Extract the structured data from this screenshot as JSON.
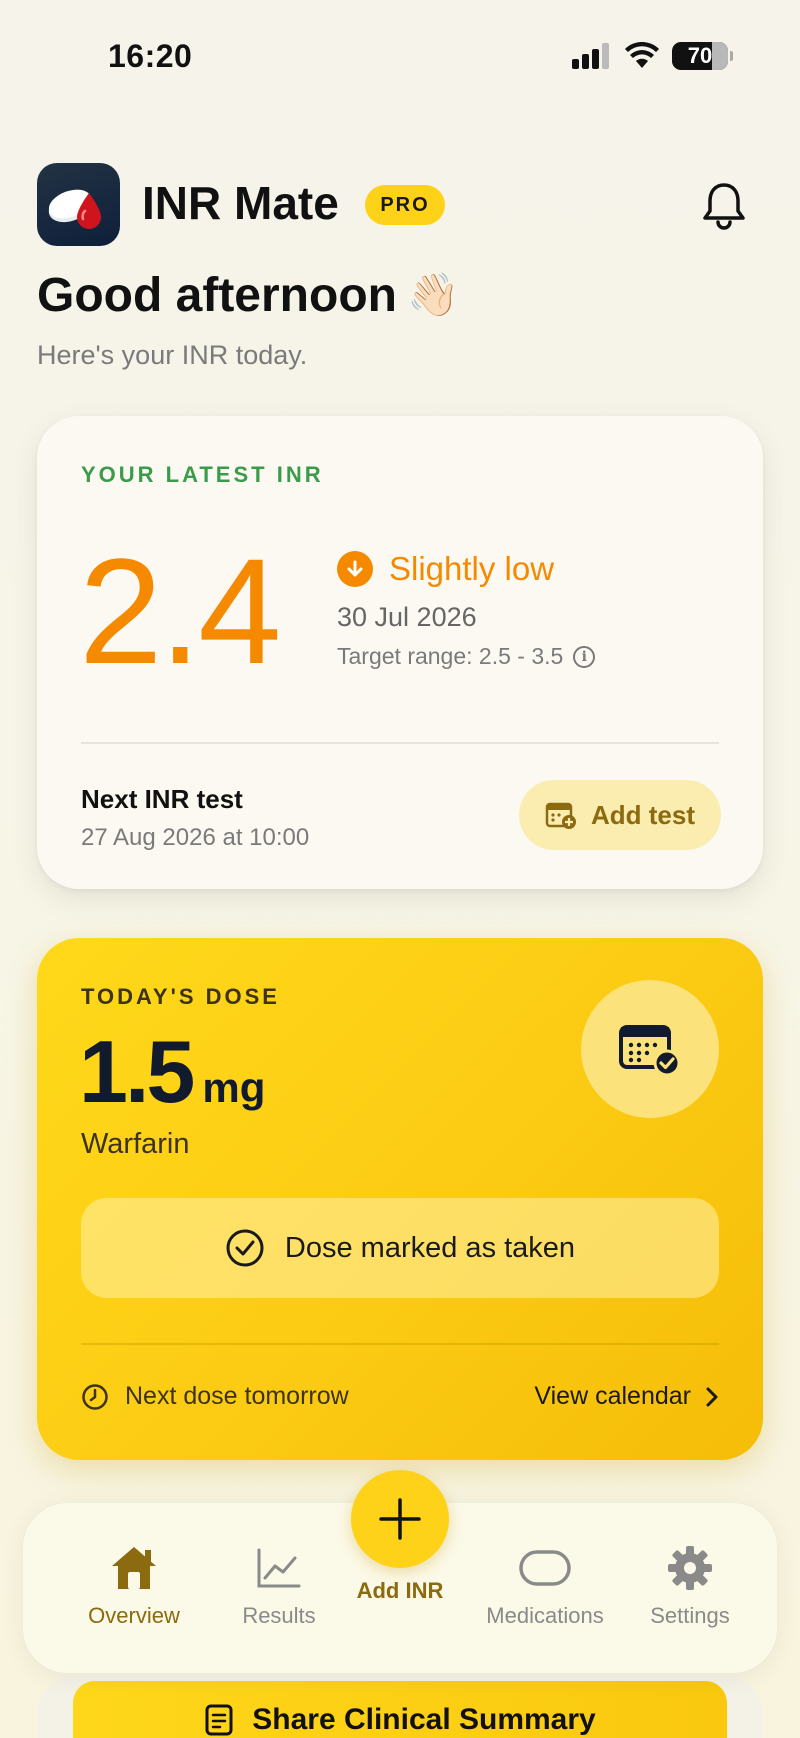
{
  "status_bar": {
    "time": "16:20",
    "battery": "70"
  },
  "header": {
    "app_name": "INR Mate",
    "badge": "PRO"
  },
  "greeting": {
    "title": "Good afternoon",
    "emoji": "👋🏻",
    "subtitle": "Here's your INR today."
  },
  "inr_card": {
    "label": "YOUR LATEST INR",
    "value": "2.4",
    "status": "Slightly low",
    "date": "30 Jul 2026",
    "target_range": "Target range: 2.5 - 3.5",
    "next_test_label": "Next INR test",
    "next_test_date": "27 Aug 2026 at 10:00",
    "add_test_label": "Add test",
    "accent_color": "#f58a00"
  },
  "dose_card": {
    "label": "TODAY'S DOSE",
    "value": "1.5",
    "unit": "mg",
    "drug": "Warfarin",
    "taken_label": "Dose marked as taken",
    "next_dose": "Next dose tomorrow",
    "view_calendar": "View calendar"
  },
  "tabbar": {
    "tabs": [
      {
        "label": "Overview",
        "icon": "home-icon",
        "active": true
      },
      {
        "label": "Results",
        "icon": "chart-line-icon",
        "active": false
      },
      {
        "label": "Medications",
        "icon": "pill-icon",
        "active": false
      },
      {
        "label": "Settings",
        "icon": "gear-icon",
        "active": false
      }
    ],
    "fab_label": "Add INR"
  },
  "share": {
    "label": "Share Clinical Summary"
  },
  "colors": {
    "brand_yellow": "#ffd21a",
    "status_orange": "#f58a00",
    "label_green": "#3a9c4a"
  }
}
